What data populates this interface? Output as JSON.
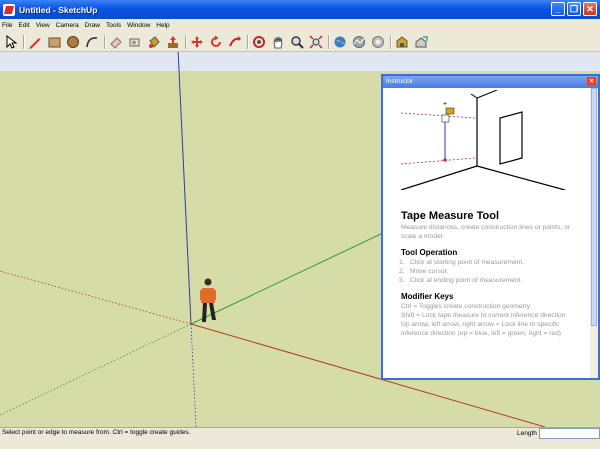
{
  "window": {
    "title": "Untitled - SketchUp"
  },
  "menu": [
    "File",
    "Edit",
    "View",
    "Camera",
    "Draw",
    "Tools",
    "Window",
    "Help"
  ],
  "toolbar": {
    "tools": [
      {
        "name": "select-tool",
        "icon": "arrow-cursor-icon"
      },
      {
        "name": "pencil-tool",
        "icon": "pencil-icon"
      },
      {
        "name": "rectangle-tool",
        "icon": "rectangle-icon"
      },
      {
        "name": "circle-tool",
        "icon": "circle-icon"
      },
      {
        "name": "arc-tool",
        "icon": "arc-icon"
      },
      {
        "name": "eraser-tool",
        "icon": "eraser-icon"
      },
      {
        "name": "tape-measure-tool",
        "icon": "tape-measure-icon"
      },
      {
        "name": "paint-bucket-tool",
        "icon": "paint-bucket-icon"
      },
      {
        "name": "push-pull-tool",
        "icon": "push-pull-icon"
      },
      {
        "name": "move-tool",
        "icon": "move-icon"
      },
      {
        "name": "rotate-tool",
        "icon": "rotate-icon"
      },
      {
        "name": "follow-me-tool",
        "icon": "follow-me-icon"
      },
      {
        "name": "orbit-tool",
        "icon": "orbit-icon"
      },
      {
        "name": "pan-tool",
        "icon": "hand-icon"
      },
      {
        "name": "zoom-tool",
        "icon": "magnifier-icon"
      },
      {
        "name": "zoom-extents-tool",
        "icon": "zoom-extents-icon"
      },
      {
        "name": "get-current-view-tool",
        "icon": "globe-icon"
      },
      {
        "name": "toggle-terrain-tool",
        "icon": "terrain-icon"
      },
      {
        "name": "place-model-tool",
        "icon": "place-model-icon"
      },
      {
        "name": "get-models-tool",
        "icon": "warehouse-icon"
      },
      {
        "name": "share-model-tool",
        "icon": "share-icon"
      }
    ]
  },
  "instructor": {
    "title": "Instructor",
    "heading": "Tape Measure Tool",
    "description": "Measure distances, create construction lines or points, or scale a model.",
    "operation_heading": "Tool Operation",
    "steps": [
      {
        "num": "1.",
        "text": "Click at starting point of measurement."
      },
      {
        "num": "2.",
        "text": "Move cursor."
      },
      {
        "num": "3.",
        "text": "Click at ending point of measurement."
      }
    ],
    "modifier_heading": "Modifier Keys",
    "modifiers": [
      "Ctrl = Toggles create construction geometry",
      "Shift = Lock tape measure to current inference direction",
      "Up arrow, left arrow, right arrow = Lock line to specific inference direction (up = blue, left = green, right = red)"
    ]
  },
  "status": {
    "hint": "Select point or edge to measure from.  Ctrl = toggle create guides.",
    "length_label": "Length",
    "length_value": ""
  },
  "colors": {
    "title_bar": "#0a54e3",
    "ground": "#d6dca8",
    "sky": "#dfe7f3",
    "red_axis": "#b23a2a",
    "green_axis": "#2aa02a",
    "blue_axis": "#3a3a9a"
  }
}
